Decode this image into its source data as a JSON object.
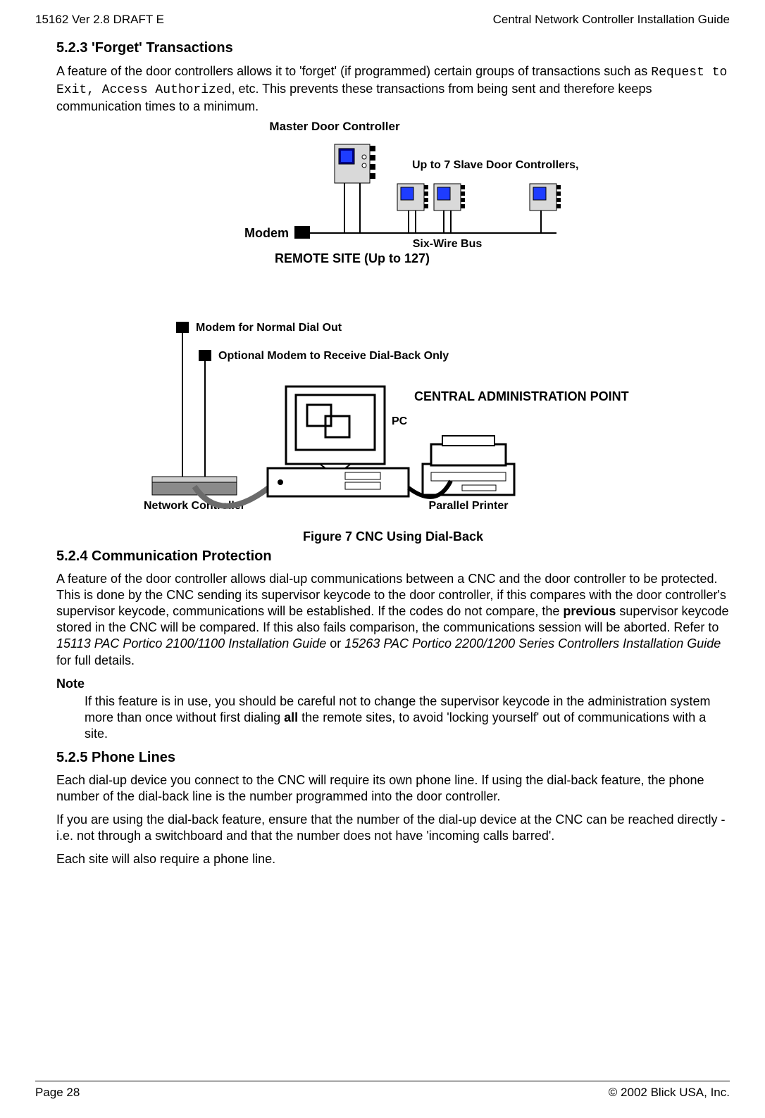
{
  "header": {
    "left": "15162 Ver 2.8 DRAFT E",
    "right": "Central Network Controller Installation Guide"
  },
  "sections": {
    "s523": {
      "title": "5.2.3 'Forget' Transactions",
      "p1a": "A feature of the door controllers allows it to 'forget' (if programmed) certain groups of transactions such as ",
      "p1b_mono": "Request to Exit, Access Authorized",
      "p1c": ", etc. This prevents these transactions from being sent and therefore keeps communication times to a minimum."
    },
    "fig7": {
      "topLabel": "Master Door Controller",
      "slaveLabel": "Up to 7 Slave Door Controllers,",
      "modem": "Modem",
      "sixwire": "Six-Wire Bus",
      "remote": "REMOTE SITE (Up to 127)",
      "modem1": "Modem for Normal Dial Out",
      "modem2": "Optional Modem to Receive Dial-Back Only",
      "pc": "PC",
      "cap": "CENTRAL ADMINISTRATION POINT",
      "nc": "Network Controller",
      "printer": "Parallel Printer",
      "caption": "Figure 7 CNC Using Dial-Back"
    },
    "s524": {
      "title": "5.2.4 Communication Protection",
      "p1a": "A feature of the door controller allows dial-up communications between a CNC and the door controller to be protected. This is done by the CNC sending its supervisor keycode to the door controller, if this compares with the door controller's supervisor keycode, communications will be established. If the codes do not compare, the ",
      "p1b_bold": "previous",
      "p1c": " supervisor keycode stored in the CNC will be compared. If this also fails comparison, the communications session will be aborted. Refer to ",
      "p1d_ital": "15113 PAC Portico 2100/1100 Installation Guide",
      "p1e": " or ",
      "p1f_ital": "15263 PAC Portico 2200/1200 Series Controllers Installation Guide",
      "p1g": " for full details.",
      "noteLabel": "Note",
      "note_a": "If this feature is in use, you should be careful not to change the supervisor keycode in the administration system more than once without first dialing ",
      "note_b_bold": "all",
      "note_c": " the remote sites, to avoid 'locking yourself' out of communications with a site."
    },
    "s525": {
      "title": "5.2.5 Phone Lines",
      "p1": "Each dial-up device you connect to the CNC will require its own phone line. If using the dial-back feature, the phone number of the dial-back line is the number programmed into the door controller.",
      "p2": "If you are using the dial-back feature, ensure that the number of the dial-up device at the CNC can be reached directly - i.e. not through a switchboard and that the number does not have 'incoming calls barred'.",
      "p3": "Each site will also require a phone line."
    }
  },
  "footer": {
    "left": "Page 28",
    "right": "© 2002 Blick USA, Inc."
  }
}
